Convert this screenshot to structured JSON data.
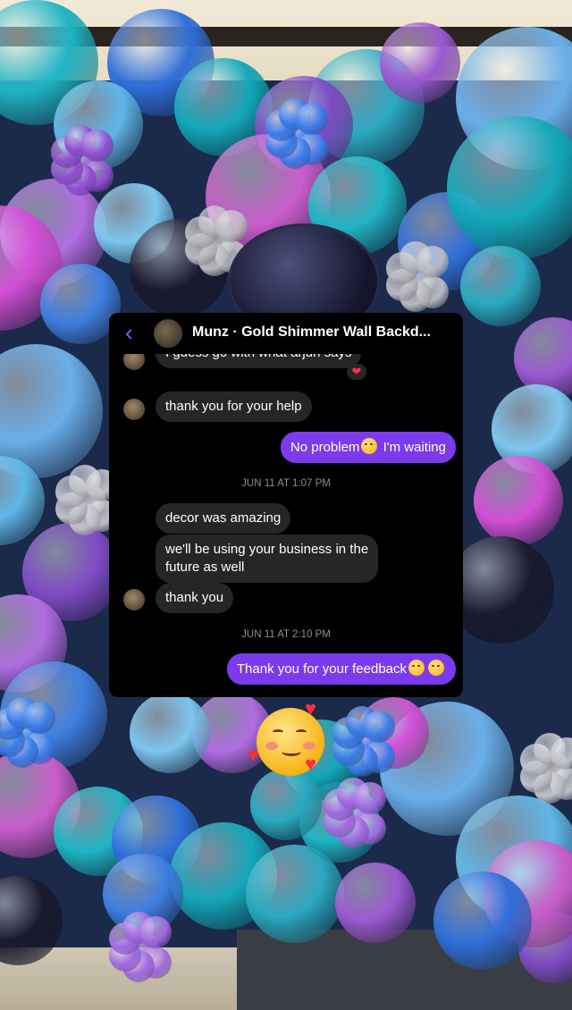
{
  "chat": {
    "title": "Munz · Gold Shimmer Wall Backd...",
    "partial_message": "I guess go with what arjun says",
    "partial_reaction": "❤",
    "messages": [
      {
        "dir": "in",
        "text": "thank you for your help"
      },
      {
        "dir": "out",
        "text_before": "No problem",
        "text_after": " I'm waiting"
      },
      {
        "timestamp": "JUN 11 AT 1:07 PM"
      },
      {
        "dir": "in",
        "text": "decor was amazing"
      },
      {
        "dir": "in",
        "text_line1": "we'll be using your business in the",
        "text_line2": "future as well"
      },
      {
        "dir": "in",
        "text": "thank you"
      },
      {
        "timestamp": "JUN 11 AT 2:10 PM"
      },
      {
        "dir": "out",
        "text": "Thank you for your feedback"
      }
    ]
  },
  "icons": {
    "back": "chevron-left-icon",
    "sticker": "smiling-face-with-hearts-emoji",
    "emoji_wink": "winking-face-emoji",
    "emoji_hearts": "smiling-face-with-hearts-emoji"
  },
  "colors": {
    "accent": "#8a5cf6",
    "outgoing_bubble": "#7c3aed",
    "incoming_bubble": "#262626",
    "card_bg": "#000000"
  }
}
